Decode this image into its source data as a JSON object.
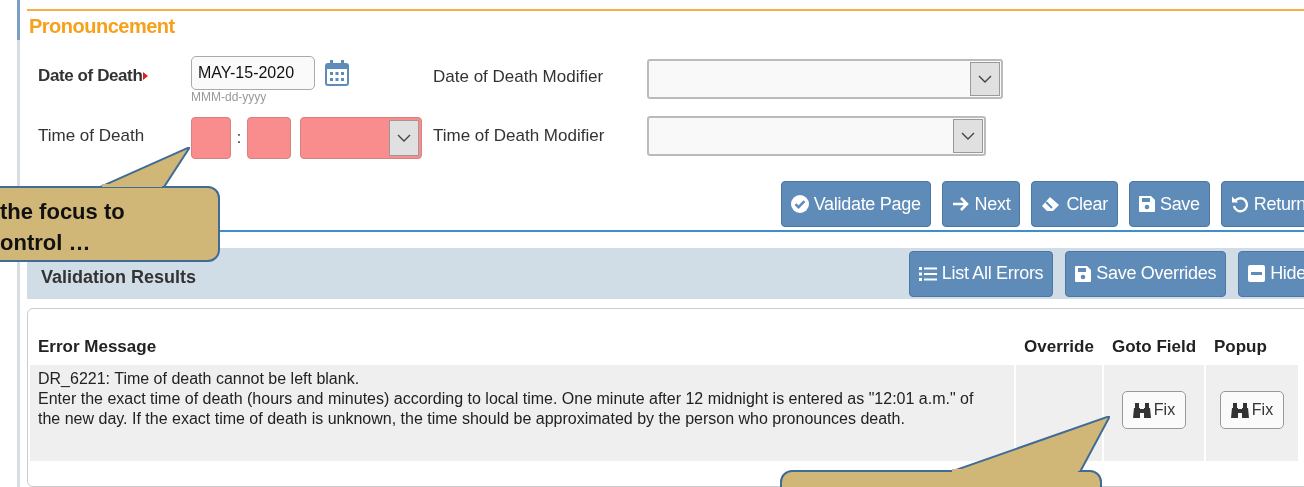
{
  "section": {
    "title": "Pronouncement"
  },
  "date_of_death": {
    "label": "Date of Death",
    "required": true,
    "value": "MAY-15-2020",
    "format_hint": "MMM-dd-yyyy"
  },
  "date_of_death_modifier": {
    "label": "Date of Death Modifier"
  },
  "time_of_death": {
    "label": "Time of Death",
    "separator": ":",
    "invalid": true
  },
  "time_of_death_modifier": {
    "label": "Time of Death Modifier"
  },
  "actions": [
    {
      "label": "Validate Page",
      "kind": "check"
    },
    {
      "label": "Next",
      "kind": "arrow"
    },
    {
      "label": "Clear",
      "kind": "eraser"
    },
    {
      "label": "Save",
      "kind": "save"
    },
    {
      "label": "Return",
      "kind": "undo"
    }
  ],
  "validation": {
    "title": "Validation Results",
    "actions": [
      {
        "label": "List All Errors",
        "kind": "list"
      },
      {
        "label": "Save Overrides",
        "kind": "save"
      },
      {
        "label": "Hide",
        "kind": "minus"
      }
    ],
    "table": {
      "columns": [
        "Error Message",
        "Override",
        "Goto Field",
        "Popup"
      ],
      "rows": [
        {
          "code_line": "DR_6221:  Time of death cannot be left blank.",
          "detail": "Enter the exact time of death (hours and minutes) according to local time. One minute after 12 midnight is entered as \"12:01 a.m.\" of the new day. If the exact time of death is unknown, the time should be approximated by the person who pronounces death.",
          "goto_button": "Fix",
          "popup_button": "Fix"
        }
      ]
    }
  },
  "callouts": [
    {
      "kind": "field",
      "lines": [
        "the focus to",
        "ontrol …"
      ]
    },
    {
      "kind": "button"
    }
  ]
}
